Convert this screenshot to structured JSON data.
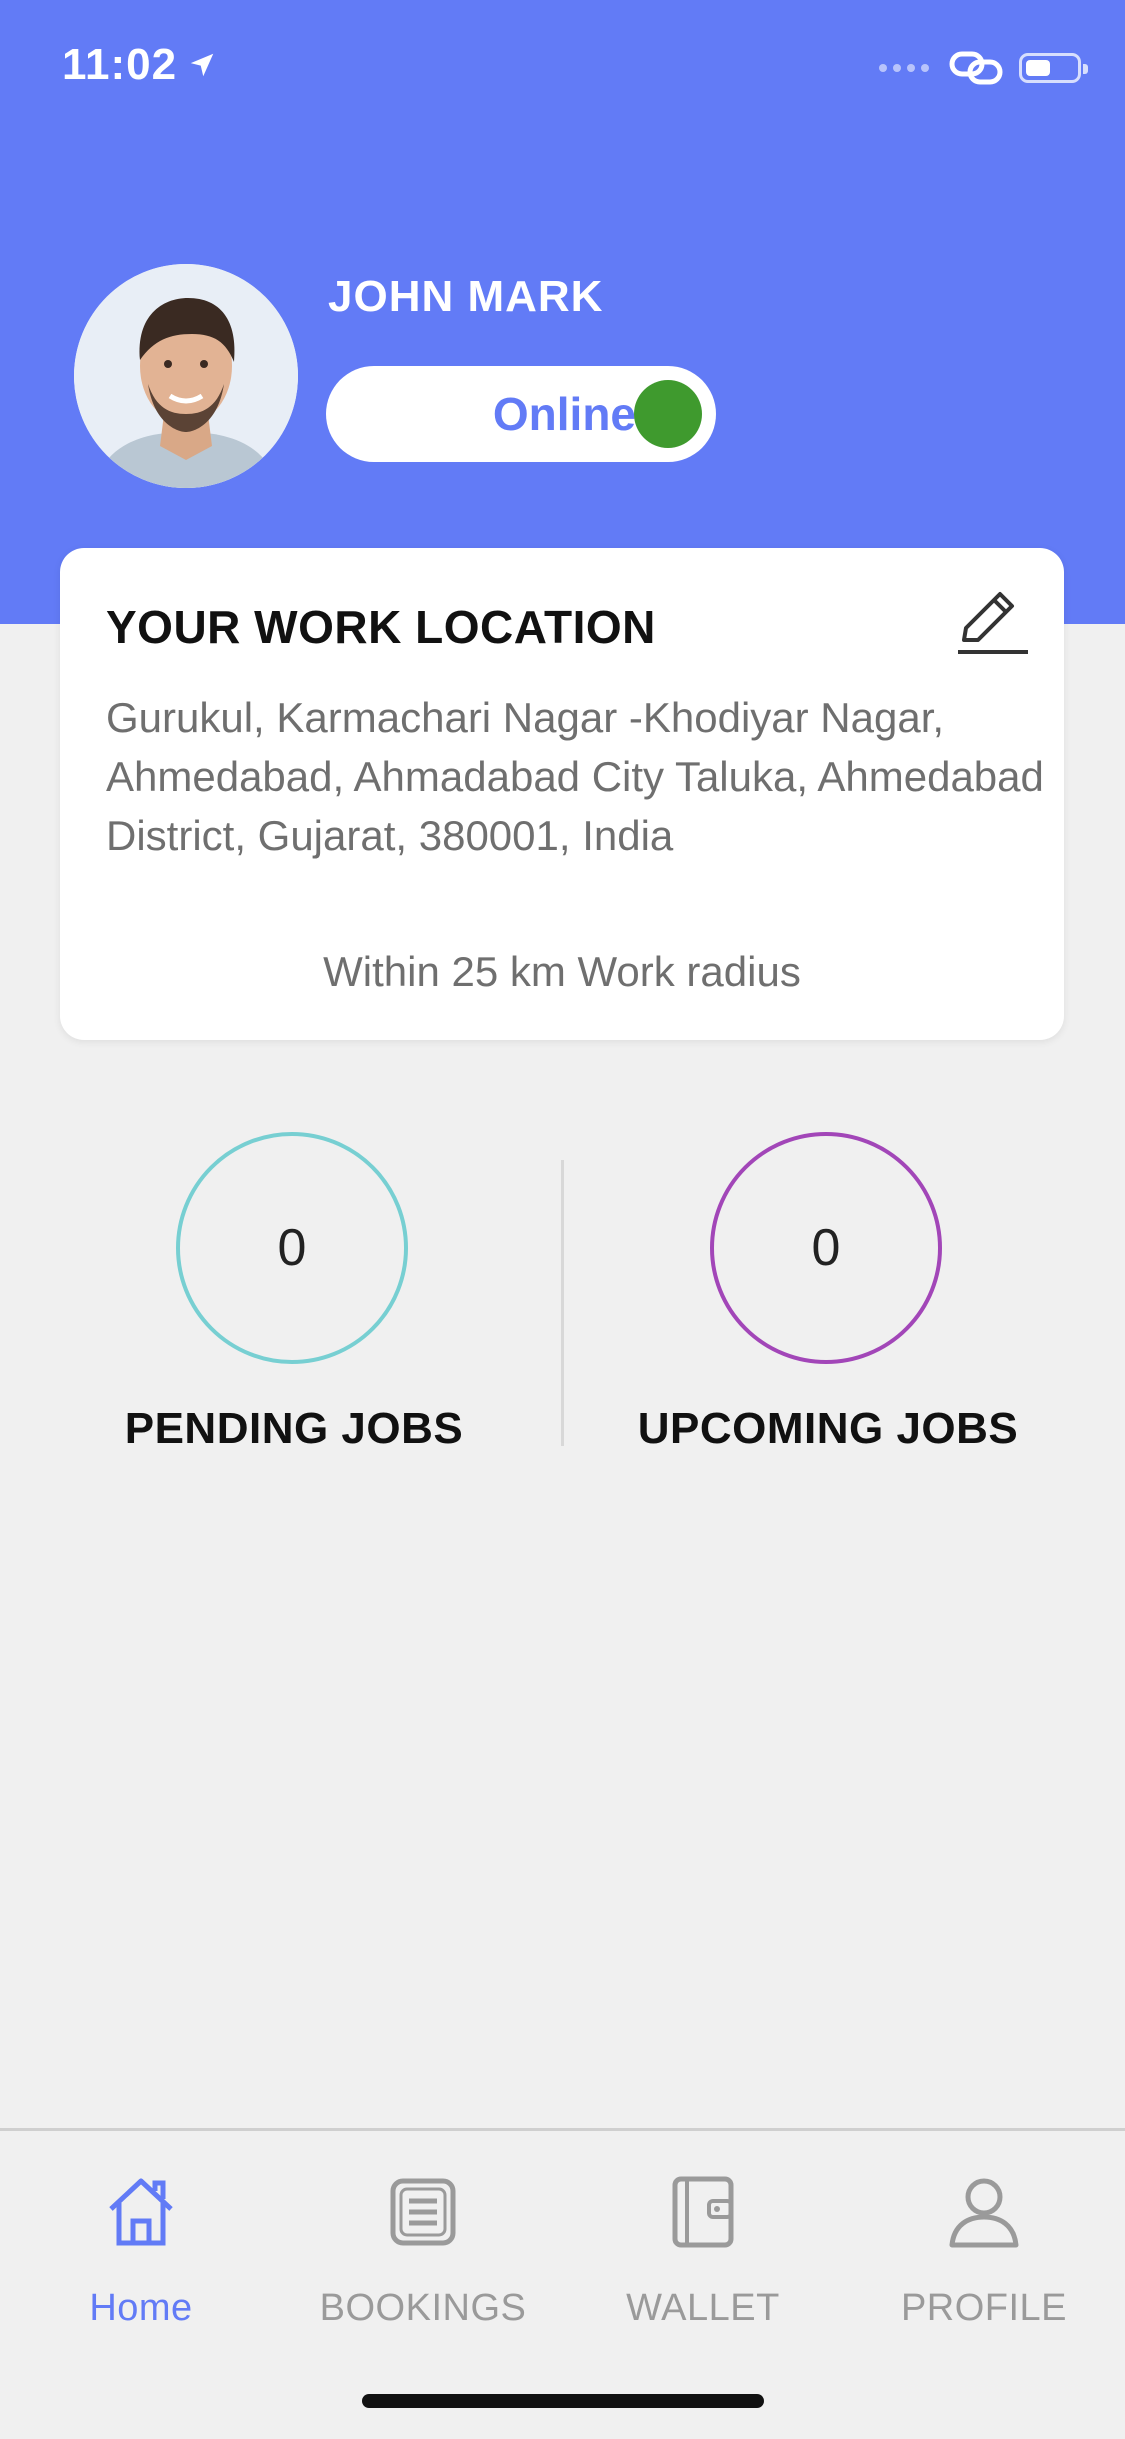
{
  "status_bar": {
    "time": "11:02"
  },
  "profile": {
    "name": "JOHN MARK",
    "status": "Online"
  },
  "work_location": {
    "title": "YOUR WORK LOCATION",
    "address": "Gurukul, Karmachari Nagar -Khodiyar Nagar, Ahmedabad, Ahmadabad City Taluka, Ahmedabad District, Gujarat, 380001, India",
    "radius": "Within 25 km Work radius"
  },
  "jobs": {
    "pending": {
      "count": "0",
      "label": "PENDING JOBS",
      "color": "#77cfd2"
    },
    "upcoming": {
      "count": "0",
      "label": "UPCOMING JOBS",
      "color": "#a246b8"
    }
  },
  "tabs": [
    {
      "label": "Home",
      "icon": "home-icon",
      "active": true
    },
    {
      "label": "BOOKINGS",
      "icon": "bookings-icon",
      "active": false
    },
    {
      "label": "WALLET",
      "icon": "wallet-icon",
      "active": false
    },
    {
      "label": "PROFILE",
      "icon": "profile-icon",
      "active": false
    }
  ],
  "colors": {
    "primary": "#627bf6",
    "online_dot": "#3f9a2e",
    "background": "#f0f0f0"
  }
}
